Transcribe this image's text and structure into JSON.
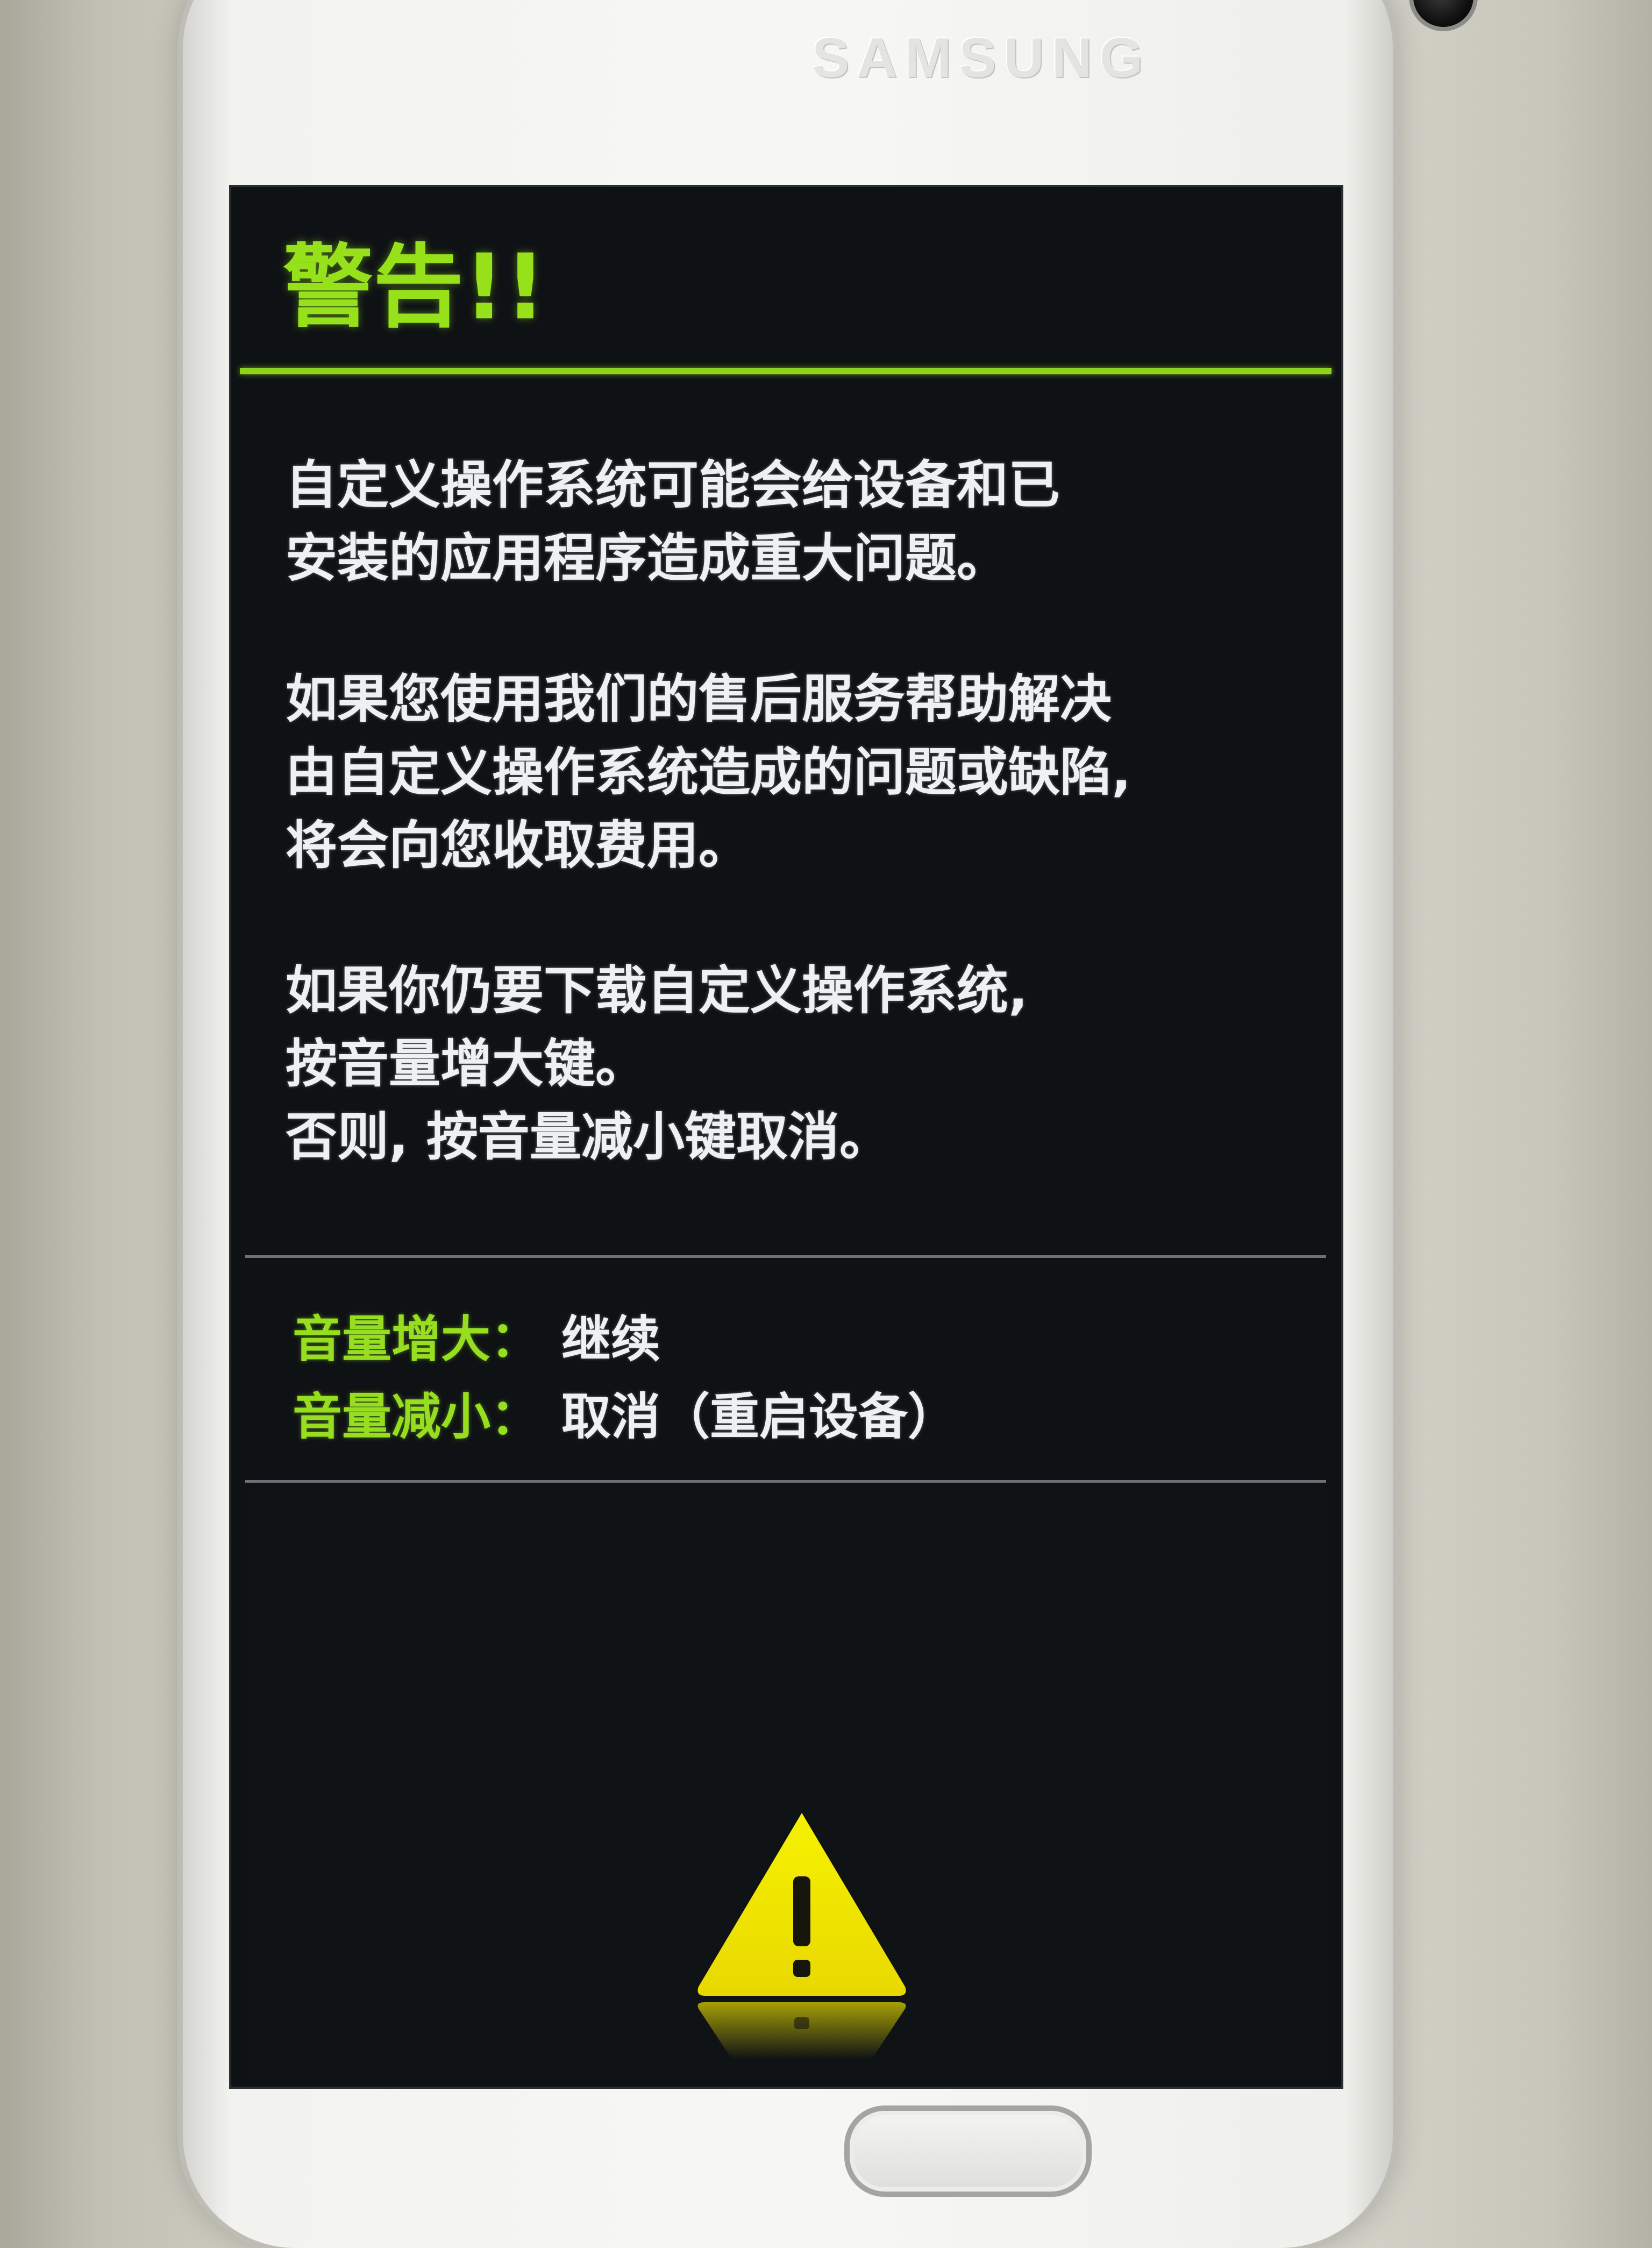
{
  "device": {
    "brand": "SAMSUNG"
  },
  "warning": {
    "title": "警告!!",
    "paragraphs": [
      {
        "lines": [
          "自定义操作系统可能会给设备和已",
          "安装的应用程序造成重大问题。"
        ]
      },
      {
        "lines": [
          "如果您使用我们的售后服务帮助解决",
          "由自定义操作系统造成的问题或缺陷,",
          "将会向您收取费用。"
        ]
      },
      {
        "lines": [
          "如果你仍要下载自定义操作系统,",
          "按音量增大键。",
          "否则, 按音量减小键取消。"
        ]
      }
    ]
  },
  "controls": [
    {
      "key": "音量增大：",
      "action": "继续"
    },
    {
      "key": "音量减小：",
      "action": "取消（重启设备）"
    }
  ],
  "colors": {
    "accent_green": "#97e11a",
    "screen_background": "#0f1215",
    "text_white": "#eef0f2",
    "warning_yellow": "#f2f000"
  },
  "icons": {
    "warning": "warning-triangle-icon"
  }
}
